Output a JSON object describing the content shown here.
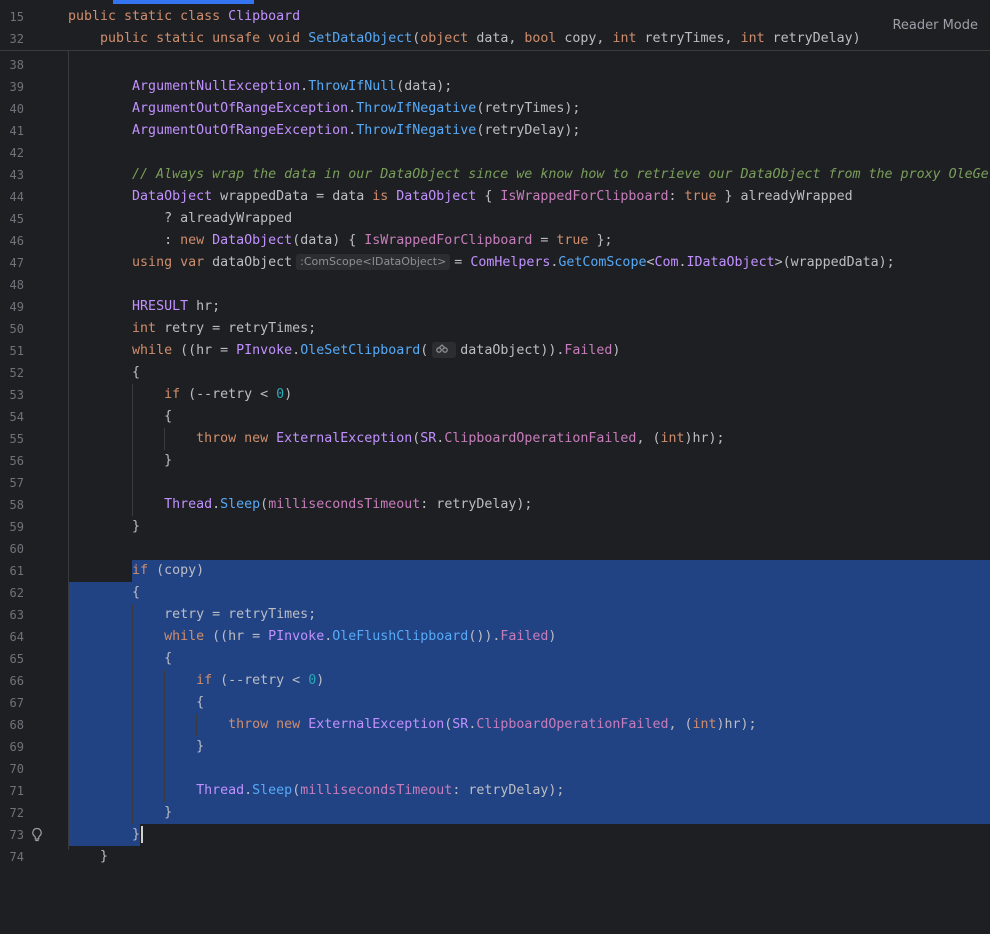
{
  "header": {
    "reader_mode_label": "Reader Mode",
    "sticky_lines": [
      {
        "num": "15",
        "text": "public static class Clipboard"
      },
      {
        "num": "32",
        "text": "    public static unsafe void SetDataObject(object data, bool copy, int retryTimes, int retryDelay)"
      }
    ]
  },
  "lines": [
    {
      "num": "38"
    },
    {
      "num": "39",
      "text": "        ArgumentNullException.ThrowIfNull(data);"
    },
    {
      "num": "40",
      "text": "        ArgumentOutOfRangeException.ThrowIfNegative(retryTimes);"
    },
    {
      "num": "41",
      "text": "        ArgumentOutOfRangeException.ThrowIfNegative(retryDelay);"
    },
    {
      "num": "42"
    },
    {
      "num": "43",
      "text": "        // Always wrap the data in our DataObject since we know how to retrieve our DataObject from the proxy OleGet"
    },
    {
      "num": "44",
      "text": "        DataObject wrappedData = data is DataObject { IsWrappedForClipboard: true } alreadyWrapped"
    },
    {
      "num": "45",
      "text": "            ? alreadyWrapped"
    },
    {
      "num": "46",
      "text": "            : new DataObject(data) { IsWrappedForClipboard = true };"
    },
    {
      "num": "47",
      "text": "        using var dataObject :ComScope<IDataObject> = ComHelpers.GetComScope<Com.IDataObject>(wrappedData);"
    },
    {
      "num": "48"
    },
    {
      "num": "49",
      "text": "        HRESULT hr;"
    },
    {
      "num": "50",
      "text": "        int retry = retryTimes;"
    },
    {
      "num": "51",
      "text": "        while ((hr = PInvoke.OleSetClipboard(dataObject)).Failed)"
    },
    {
      "num": "52",
      "text": "        {"
    },
    {
      "num": "53",
      "text": "            if (--retry < 0)"
    },
    {
      "num": "54",
      "text": "            {"
    },
    {
      "num": "55",
      "text": "                throw new ExternalException(SR.ClipboardOperationFailed, (int)hr);"
    },
    {
      "num": "56",
      "text": "            }"
    },
    {
      "num": "57"
    },
    {
      "num": "58",
      "text": "            Thread.Sleep(millisecondsTimeout: retryDelay);"
    },
    {
      "num": "59",
      "text": "        }"
    },
    {
      "num": "60"
    },
    {
      "num": "61",
      "text": "        if (copy)"
    },
    {
      "num": "62",
      "text": "        {"
    },
    {
      "num": "63",
      "text": "            retry = retryTimes;"
    },
    {
      "num": "64",
      "text": "            while ((hr = PInvoke.OleFlushClipboard()).Failed)"
    },
    {
      "num": "65",
      "text": "            {"
    },
    {
      "num": "66",
      "text": "                if (--retry < 0)"
    },
    {
      "num": "67",
      "text": "                {"
    },
    {
      "num": "68",
      "text": "                    throw new ExternalException(SR.ClipboardOperationFailed, (int)hr);"
    },
    {
      "num": "69",
      "text": "                }"
    },
    {
      "num": "70"
    },
    {
      "num": "71",
      "text": "                Thread.Sleep(millisecondsTimeout: retryDelay);"
    },
    {
      "num": "72",
      "text": "            }"
    },
    {
      "num": "73",
      "text": "        }"
    },
    {
      "num": "74",
      "text": "    }"
    }
  ],
  "inlay_hints": {
    "type_hint": ":ComScope<IDataObject>"
  },
  "colors": {
    "background": "#1e1f22",
    "selection": "#214283",
    "keyword": "#cf8e6d",
    "type": "#c191ff",
    "method": "#56a8f5",
    "number": "#2aacb8",
    "comment": "#7a9e5b",
    "accent_tab": "#3574f0"
  }
}
